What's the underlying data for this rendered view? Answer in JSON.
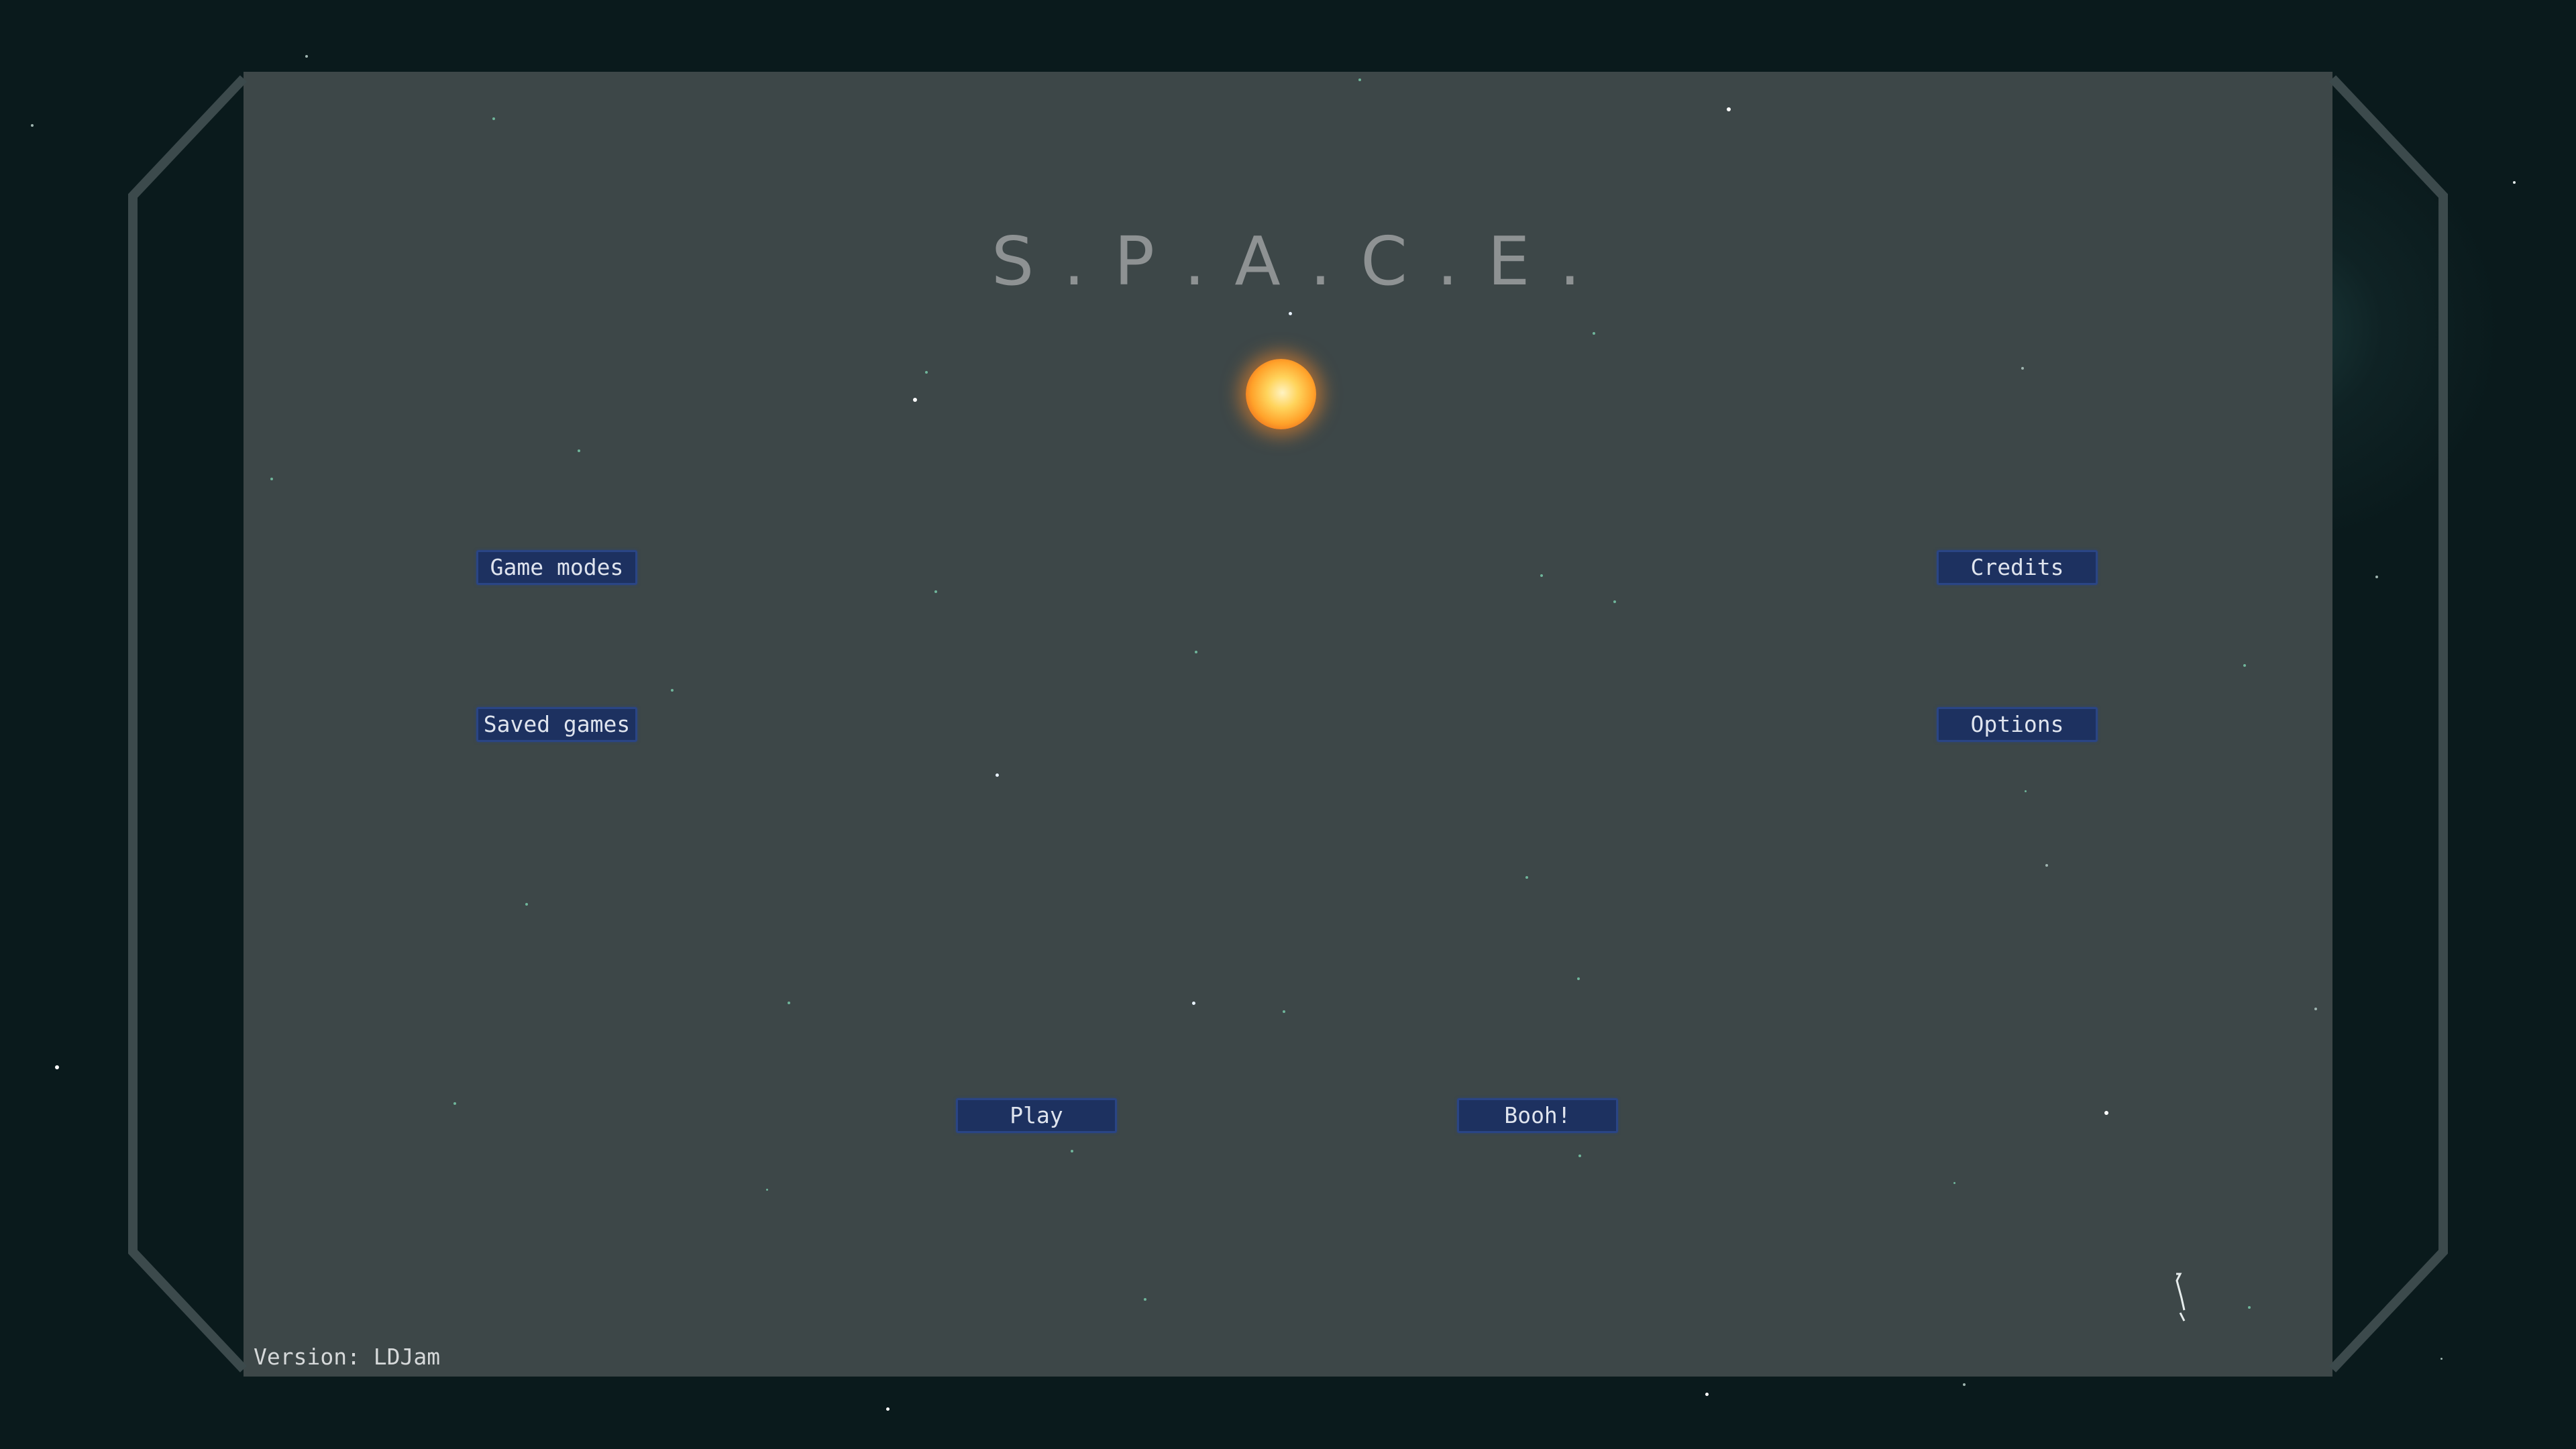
{
  "title": "S . P . A . C . E .",
  "menu": {
    "game_modes": "Game modes",
    "credits": "Credits",
    "saved_games": "Saved games",
    "options": "Options",
    "play": "Play",
    "booh": "Booh!"
  },
  "footer": {
    "version": "Version: LDJam"
  },
  "icons": {
    "logo": "sun-icon",
    "loading": "loading-spinner-icon"
  },
  "colors": {
    "background": "#0a1a1c",
    "panel": "#3d4748",
    "frame": "#3c4a4c",
    "button_fill": "#1d3160",
    "button_border": "#2a4585",
    "title_text": "#8e9293",
    "sun": "#ffa22a"
  }
}
